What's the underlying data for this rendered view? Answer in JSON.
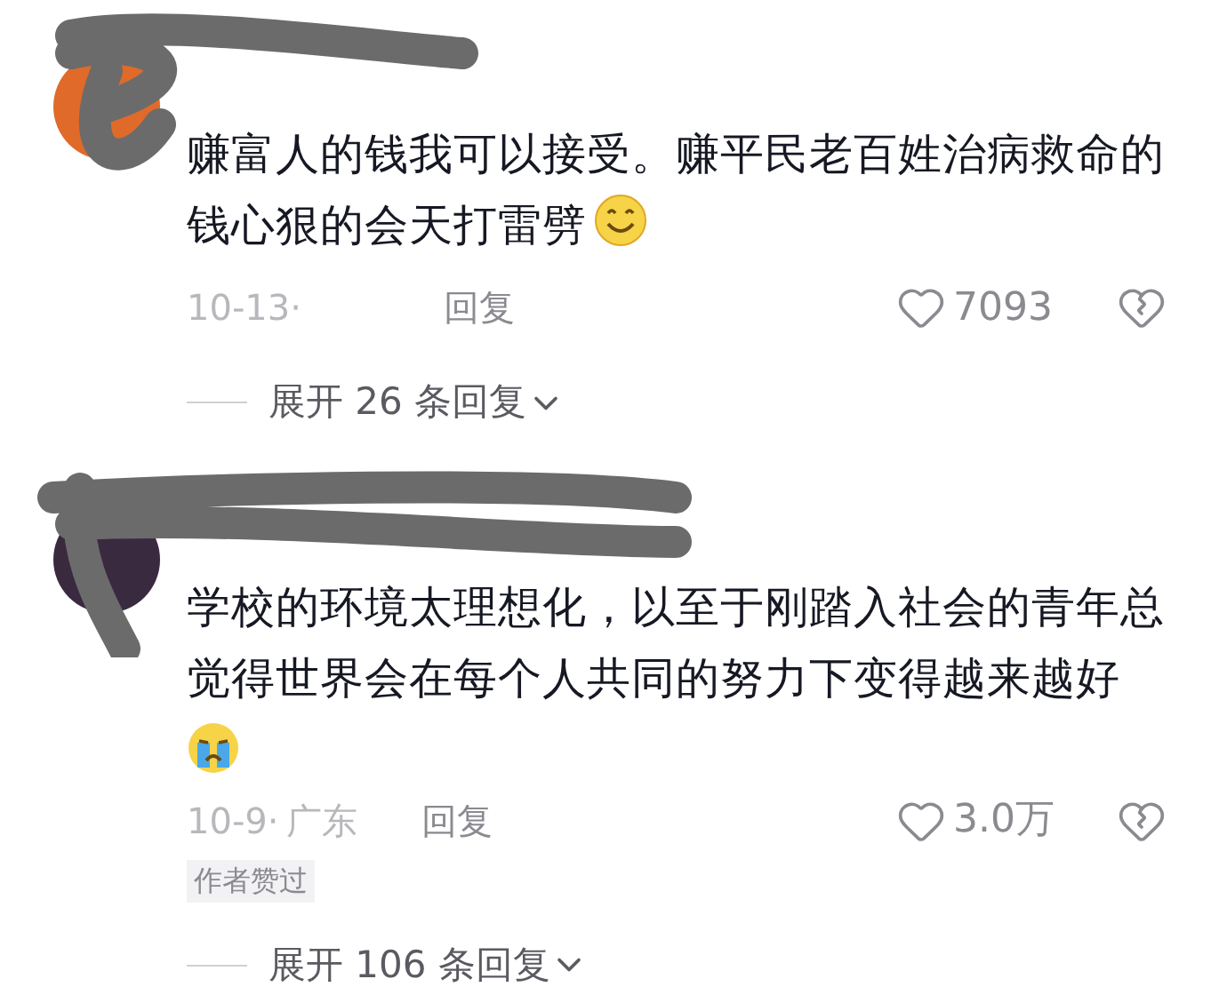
{
  "comments": [
    {
      "text": "赚富人的钱我可以接受。赚平民老百姓治病救命的钱心狠的会天打雷劈",
      "emoji": {
        "kind": "smile"
      },
      "date": "10-13·",
      "reply": "回复",
      "likes": "7093",
      "expand": "展开 26 条回复"
    },
    {
      "text": "学校的环境太理想化，以至于刚踏入社会的青年总觉得世界会在每个人共同的努力下变得越来越好",
      "emoji": {
        "kind": "cry"
      },
      "date": "10-9·",
      "location": "广东",
      "reply": "回复",
      "likes": "3.0万",
      "badge": "作者赞过",
      "expand": "展开 106 条回复"
    }
  ]
}
